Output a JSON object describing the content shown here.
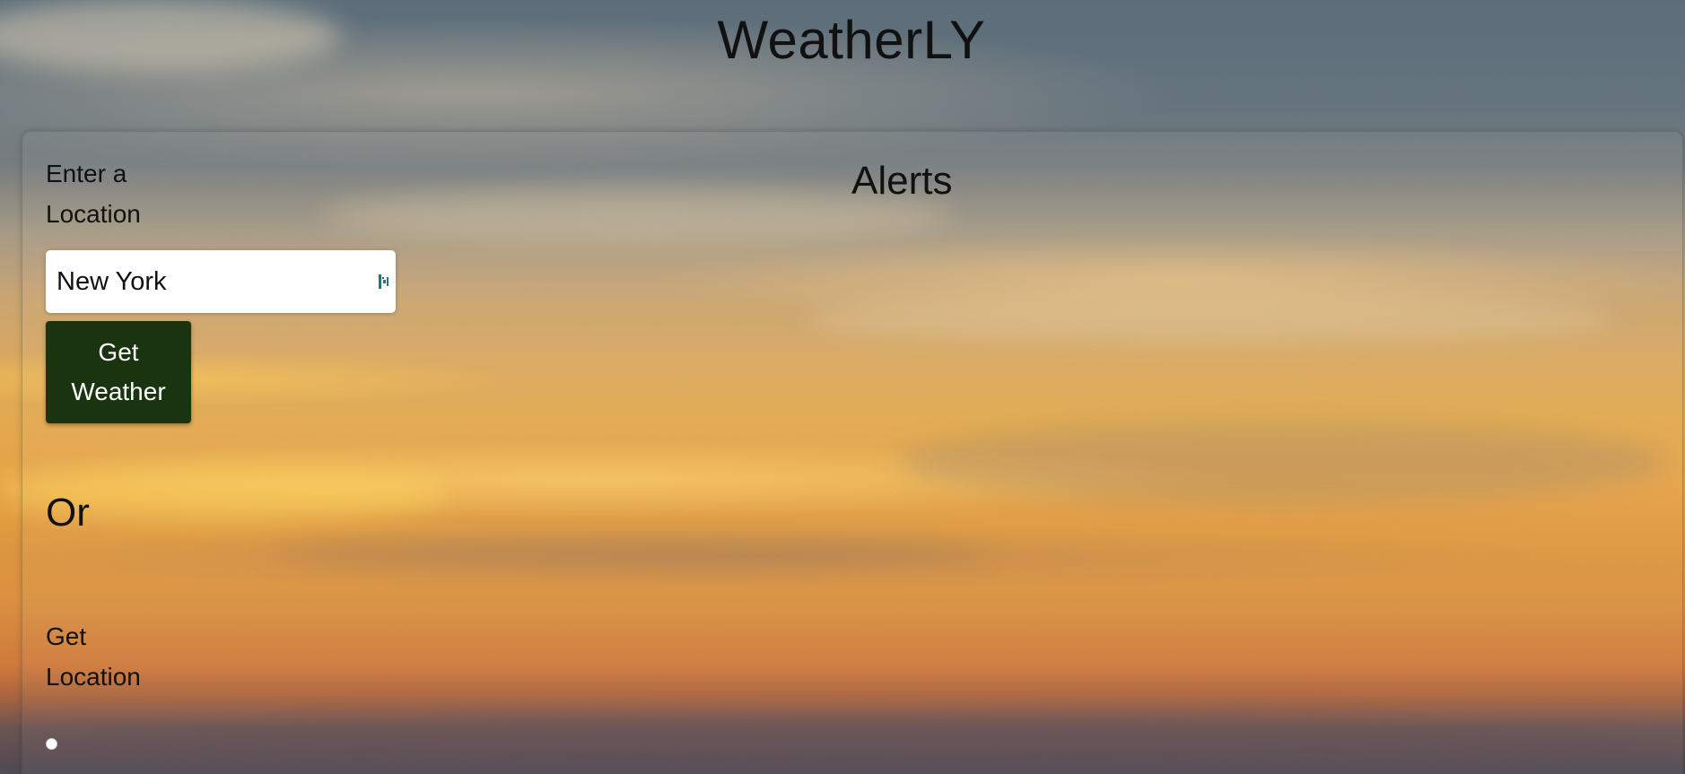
{
  "header": {
    "title": "WeatherLY"
  },
  "search": {
    "label": "Enter a Location",
    "value": "New York",
    "input_icon": "autofill-key-icon",
    "button_label": "Get Weather"
  },
  "divider_text": "Or",
  "geolocation": {
    "label": "Get Location",
    "control_icon": "radio-dot"
  },
  "alerts": {
    "title": "Alerts"
  },
  "colors": {
    "button_bg": "#1b3410",
    "button_text": "#ffffff",
    "text": "#111111"
  }
}
